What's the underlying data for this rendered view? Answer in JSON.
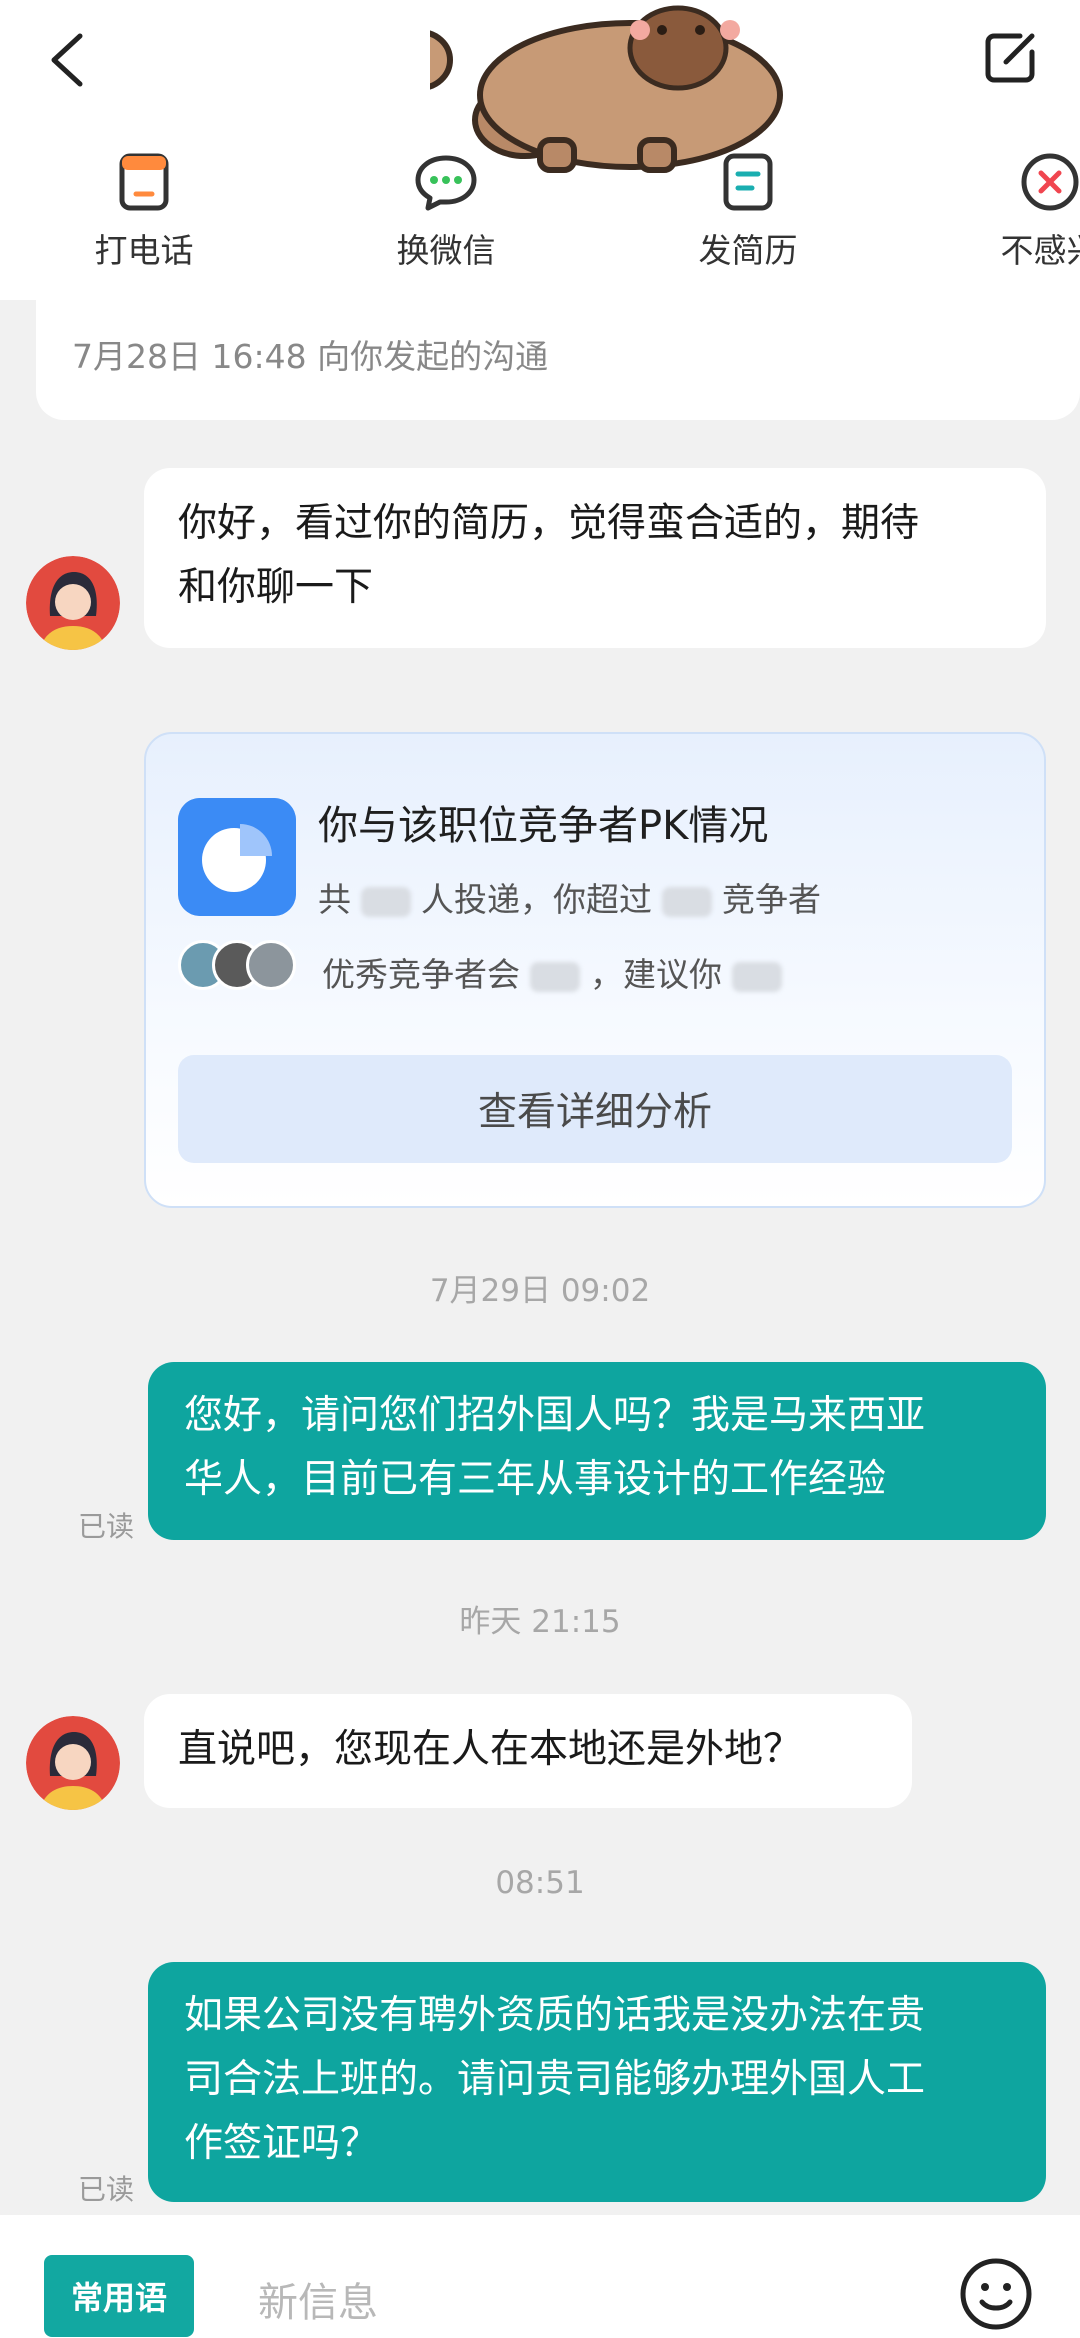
{
  "actions": [
    {
      "label": "打电话",
      "icon": "phone-icon"
    },
    {
      "label": "换微信",
      "icon": "wechat-icon"
    },
    {
      "label": "发简历",
      "icon": "resume-icon"
    },
    {
      "label": "不感兴",
      "icon": "not-interested-icon"
    }
  ],
  "info": {
    "text": "7月28日 16:48 向你发起的沟通"
  },
  "messages": {
    "m1": {
      "line1": "你好，看过你的简历，觉得蛮合适的，期待",
      "line2": "和你聊一下"
    },
    "t1": "7月29日 09:02",
    "m2": {
      "line1": "您好，请问您们招外国人吗？我是马来西亚",
      "line2": "华人，目前已有三年从事设计的工作经验",
      "status": "已读"
    },
    "t2": "昨天 21:15",
    "m3": {
      "text": "直说吧，您现在人在本地还是外地？"
    },
    "t3": "08:51",
    "m4": {
      "line1": "如果公司没有聘外资质的话我是没办法在贵",
      "line2": "司合法上班的。请问贵司能够办理外国人工",
      "line3": "作签证吗？",
      "status": "已读"
    }
  },
  "pk": {
    "title": "你与该职位竞争者PK情况",
    "line1_a": "共",
    "line1_b": "人投递，你超过",
    "line1_c": "竞争者",
    "line2_a": "优秀竞争者会",
    "line2_b": "，建议你",
    "button": "查看详细分析"
  },
  "input": {
    "quick_label": "常用语",
    "placeholder": "新信息"
  },
  "colors": {
    "accent": "#0ea59f",
    "pk_icon": "#3b8bf5"
  }
}
